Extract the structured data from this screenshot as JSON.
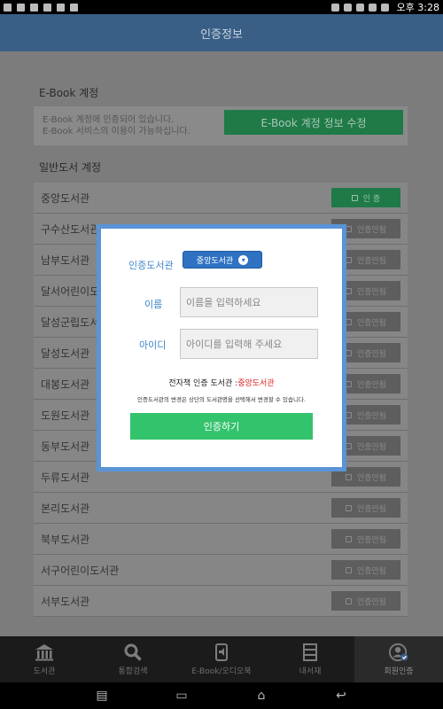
{
  "status": {
    "time": "오후 3:28"
  },
  "header": {
    "title": "인증정보"
  },
  "ebook": {
    "section_title": "E-Book 계정",
    "message_line1": "E-Book 계정에 인증되어 있습니다.",
    "message_line2": "E-Book 서비스의 이용이 가능하십니다.",
    "edit_button": "E-Book 계정 정보 수정"
  },
  "general": {
    "section_title": "일반도서 계정",
    "libraries": [
      {
        "name": "중앙도서관",
        "status": "인 증"
      },
      {
        "name": "구수산도서관",
        "status": "인증안됨"
      },
      {
        "name": "남부도서관",
        "status": "인증안됨"
      },
      {
        "name": "달서어린이도서관",
        "status": "인증안됨"
      },
      {
        "name": "달성군립도서관",
        "status": "인증안됨"
      },
      {
        "name": "달성도서관",
        "status": "인증안됨"
      },
      {
        "name": "대봉도서관",
        "status": "인증안됨"
      },
      {
        "name": "도원도서관",
        "status": "인증안됨"
      },
      {
        "name": "동부도서관",
        "status": "인증안됨"
      },
      {
        "name": "두류도서관",
        "status": "인증안됨"
      },
      {
        "name": "본리도서관",
        "status": "인증안됨"
      },
      {
        "name": "북부도서관",
        "status": "인증안됨"
      },
      {
        "name": "서구어린이도서관",
        "status": "인증안됨"
      },
      {
        "name": "서부도서관",
        "status": "인증안됨"
      }
    ]
  },
  "dialog": {
    "library_label": "인증도서관",
    "library_selected": "중앙도서관",
    "name_label": "이름",
    "name_placeholder": "이름을 입력하세요",
    "id_label": "아이디",
    "id_placeholder": "아이디를 입력해 주세요",
    "ebook_library_prefix": "전자책 인증 도서관 :",
    "ebook_library_value": "중앙도서관",
    "notice": "인증도서관의 변경은 상단의 도서관명을 선택해서 변경할 수 있습니다.",
    "submit": "인증하기"
  },
  "nav": [
    {
      "label": "도서관",
      "icon": "library-icon"
    },
    {
      "label": "통합검색",
      "icon": "search-icon"
    },
    {
      "label": "E-Book/오디오북",
      "icon": "ebook-icon"
    },
    {
      "label": "내서재",
      "icon": "bookshelf-icon"
    },
    {
      "label": "회원인증",
      "icon": "user-auth-icon"
    }
  ],
  "colors": {
    "header": "#3a5f86",
    "dialog_border": "#5a94d6",
    "submit": "#34c36d",
    "accent_red": "#e02020"
  }
}
